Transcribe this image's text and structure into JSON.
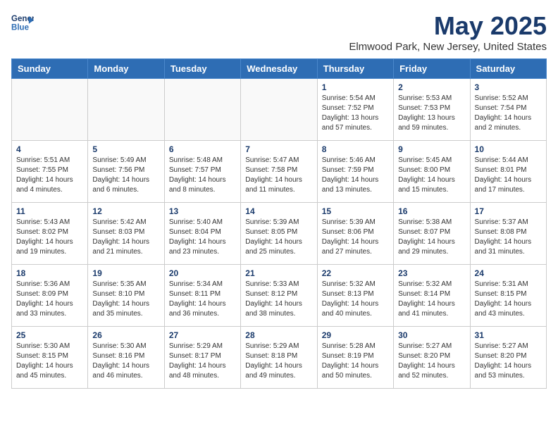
{
  "header": {
    "logo_line1": "General",
    "logo_line2": "Blue",
    "month": "May 2025",
    "location": "Elmwood Park, New Jersey, United States"
  },
  "weekdays": [
    "Sunday",
    "Monday",
    "Tuesday",
    "Wednesday",
    "Thursday",
    "Friday",
    "Saturday"
  ],
  "weeks": [
    [
      {
        "day": "",
        "info": ""
      },
      {
        "day": "",
        "info": ""
      },
      {
        "day": "",
        "info": ""
      },
      {
        "day": "",
        "info": ""
      },
      {
        "day": "1",
        "info": "Sunrise: 5:54 AM\nSunset: 7:52 PM\nDaylight: 13 hours\nand 57 minutes."
      },
      {
        "day": "2",
        "info": "Sunrise: 5:53 AM\nSunset: 7:53 PM\nDaylight: 13 hours\nand 59 minutes."
      },
      {
        "day": "3",
        "info": "Sunrise: 5:52 AM\nSunset: 7:54 PM\nDaylight: 14 hours\nand 2 minutes."
      }
    ],
    [
      {
        "day": "4",
        "info": "Sunrise: 5:51 AM\nSunset: 7:55 PM\nDaylight: 14 hours\nand 4 minutes."
      },
      {
        "day": "5",
        "info": "Sunrise: 5:49 AM\nSunset: 7:56 PM\nDaylight: 14 hours\nand 6 minutes."
      },
      {
        "day": "6",
        "info": "Sunrise: 5:48 AM\nSunset: 7:57 PM\nDaylight: 14 hours\nand 8 minutes."
      },
      {
        "day": "7",
        "info": "Sunrise: 5:47 AM\nSunset: 7:58 PM\nDaylight: 14 hours\nand 11 minutes."
      },
      {
        "day": "8",
        "info": "Sunrise: 5:46 AM\nSunset: 7:59 PM\nDaylight: 14 hours\nand 13 minutes."
      },
      {
        "day": "9",
        "info": "Sunrise: 5:45 AM\nSunset: 8:00 PM\nDaylight: 14 hours\nand 15 minutes."
      },
      {
        "day": "10",
        "info": "Sunrise: 5:44 AM\nSunset: 8:01 PM\nDaylight: 14 hours\nand 17 minutes."
      }
    ],
    [
      {
        "day": "11",
        "info": "Sunrise: 5:43 AM\nSunset: 8:02 PM\nDaylight: 14 hours\nand 19 minutes."
      },
      {
        "day": "12",
        "info": "Sunrise: 5:42 AM\nSunset: 8:03 PM\nDaylight: 14 hours\nand 21 minutes."
      },
      {
        "day": "13",
        "info": "Sunrise: 5:40 AM\nSunset: 8:04 PM\nDaylight: 14 hours\nand 23 minutes."
      },
      {
        "day": "14",
        "info": "Sunrise: 5:39 AM\nSunset: 8:05 PM\nDaylight: 14 hours\nand 25 minutes."
      },
      {
        "day": "15",
        "info": "Sunrise: 5:39 AM\nSunset: 8:06 PM\nDaylight: 14 hours\nand 27 minutes."
      },
      {
        "day": "16",
        "info": "Sunrise: 5:38 AM\nSunset: 8:07 PM\nDaylight: 14 hours\nand 29 minutes."
      },
      {
        "day": "17",
        "info": "Sunrise: 5:37 AM\nSunset: 8:08 PM\nDaylight: 14 hours\nand 31 minutes."
      }
    ],
    [
      {
        "day": "18",
        "info": "Sunrise: 5:36 AM\nSunset: 8:09 PM\nDaylight: 14 hours\nand 33 minutes."
      },
      {
        "day": "19",
        "info": "Sunrise: 5:35 AM\nSunset: 8:10 PM\nDaylight: 14 hours\nand 35 minutes."
      },
      {
        "day": "20",
        "info": "Sunrise: 5:34 AM\nSunset: 8:11 PM\nDaylight: 14 hours\nand 36 minutes."
      },
      {
        "day": "21",
        "info": "Sunrise: 5:33 AM\nSunset: 8:12 PM\nDaylight: 14 hours\nand 38 minutes."
      },
      {
        "day": "22",
        "info": "Sunrise: 5:32 AM\nSunset: 8:13 PM\nDaylight: 14 hours\nand 40 minutes."
      },
      {
        "day": "23",
        "info": "Sunrise: 5:32 AM\nSunset: 8:14 PM\nDaylight: 14 hours\nand 41 minutes."
      },
      {
        "day": "24",
        "info": "Sunrise: 5:31 AM\nSunset: 8:15 PM\nDaylight: 14 hours\nand 43 minutes."
      }
    ],
    [
      {
        "day": "25",
        "info": "Sunrise: 5:30 AM\nSunset: 8:15 PM\nDaylight: 14 hours\nand 45 minutes."
      },
      {
        "day": "26",
        "info": "Sunrise: 5:30 AM\nSunset: 8:16 PM\nDaylight: 14 hours\nand 46 minutes."
      },
      {
        "day": "27",
        "info": "Sunrise: 5:29 AM\nSunset: 8:17 PM\nDaylight: 14 hours\nand 48 minutes."
      },
      {
        "day": "28",
        "info": "Sunrise: 5:29 AM\nSunset: 8:18 PM\nDaylight: 14 hours\nand 49 minutes."
      },
      {
        "day": "29",
        "info": "Sunrise: 5:28 AM\nSunset: 8:19 PM\nDaylight: 14 hours\nand 50 minutes."
      },
      {
        "day": "30",
        "info": "Sunrise: 5:27 AM\nSunset: 8:20 PM\nDaylight: 14 hours\nand 52 minutes."
      },
      {
        "day": "31",
        "info": "Sunrise: 5:27 AM\nSunset: 8:20 PM\nDaylight: 14 hours\nand 53 minutes."
      }
    ]
  ]
}
